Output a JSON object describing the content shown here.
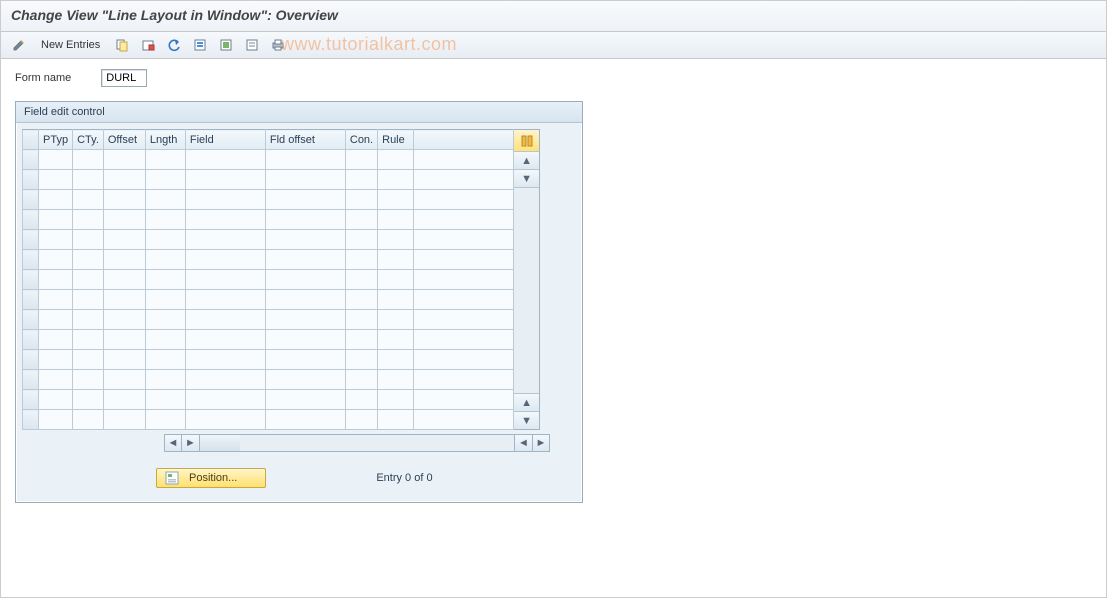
{
  "title": "Change View \"Line Layout in Window\": Overview",
  "toolbar": {
    "new_entries_label": "New Entries"
  },
  "watermark": "www.tutorialkart.com",
  "form": {
    "name_label": "Form name",
    "name_value": "DURL"
  },
  "panel": {
    "title": "Field edit control",
    "columns": {
      "ptyp": "PTyp",
      "cty": "CTy.",
      "offset": "Offset",
      "length": "Lngth",
      "field": "Field",
      "fld_offset": "Fld offset",
      "con": "Con.",
      "rule": "Rule"
    },
    "position_label": "Position...",
    "entry_text": "Entry 0 of 0"
  }
}
